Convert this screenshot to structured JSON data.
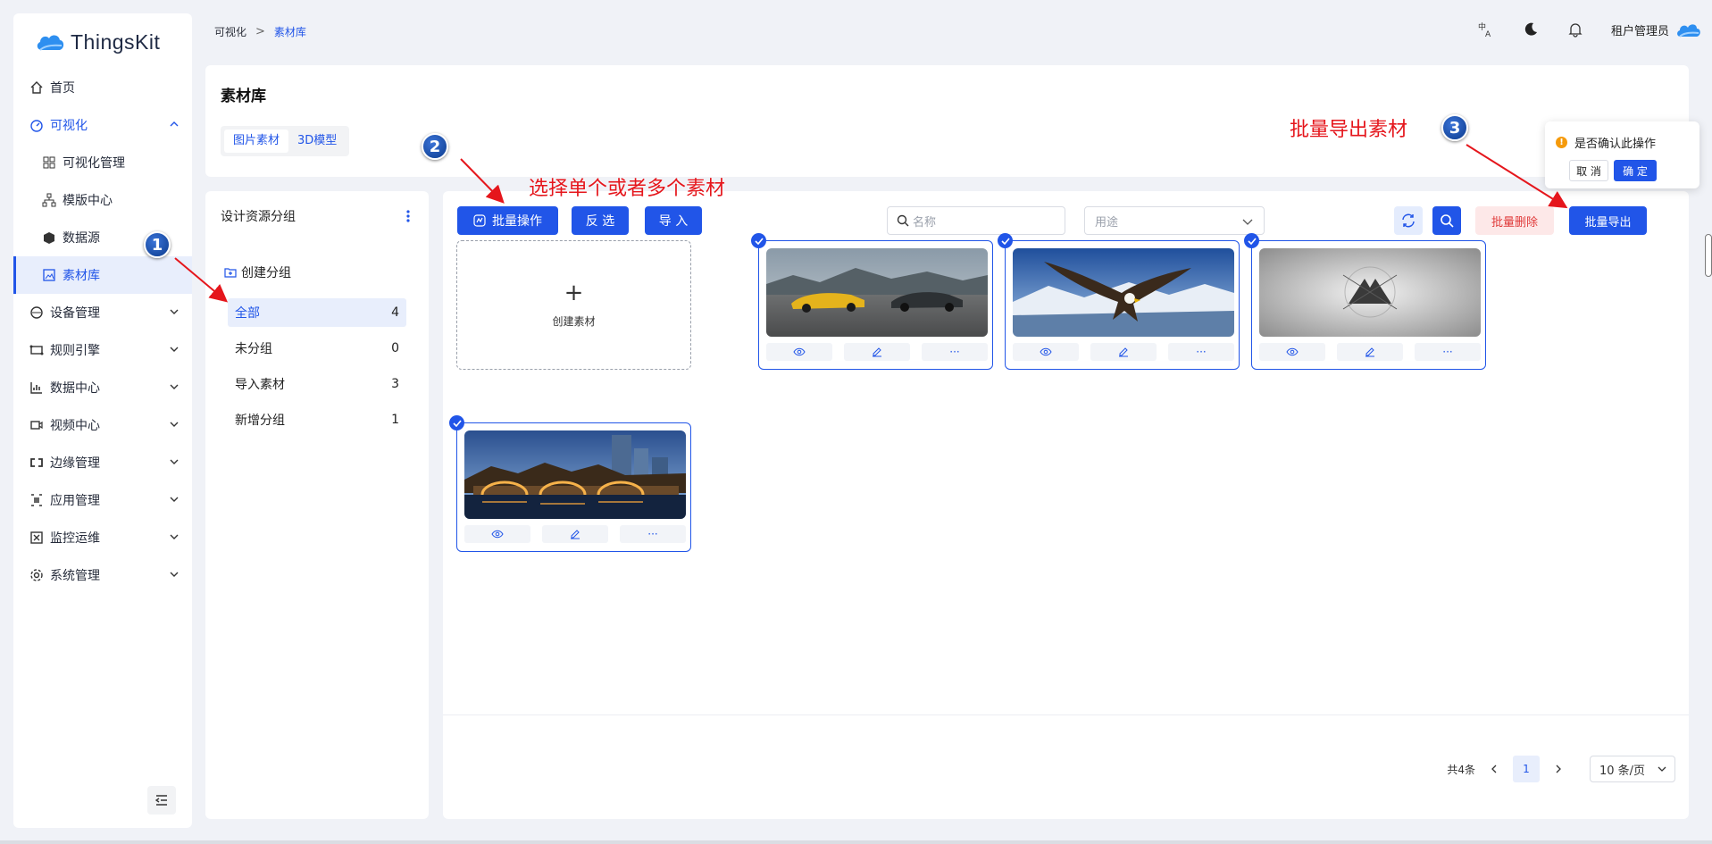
{
  "app": {
    "logo_text": "ThingsKit",
    "brand_color": "#2155e8"
  },
  "sidebar": {
    "items": [
      {
        "label": "首页",
        "icon": "home-icon"
      },
      {
        "label": "可视化",
        "icon": "dashboard-icon",
        "expanded": true
      },
      {
        "label": "可视化管理",
        "icon": "grid-icon",
        "sub": true
      },
      {
        "label": "模版中心",
        "icon": "sitemap-icon",
        "sub": true
      },
      {
        "label": "数据源",
        "icon": "cube-icon",
        "sub": true
      },
      {
        "label": "素材库",
        "icon": "picture-icon",
        "sub": true,
        "active": true
      },
      {
        "label": "设备管理",
        "icon": "device-icon"
      },
      {
        "label": "规则引擎",
        "icon": "rule-icon"
      },
      {
        "label": "数据中心",
        "icon": "chart-icon"
      },
      {
        "label": "视频中心",
        "icon": "video-icon"
      },
      {
        "label": "边缘管理",
        "icon": "edge-icon"
      },
      {
        "label": "应用管理",
        "icon": "app-icon"
      },
      {
        "label": "监控运维",
        "icon": "monitor-icon"
      },
      {
        "label": "系统管理",
        "icon": "settings-icon"
      }
    ]
  },
  "breadcrumb": {
    "parent": "可视化",
    "separator": ">",
    "current": "素材库"
  },
  "header": {
    "user": "租户管理员"
  },
  "page": {
    "title": "素材库",
    "tabs": [
      "图片素材",
      "3D模型"
    ]
  },
  "groups": {
    "title": "设计资源分组",
    "create_label": "创建分组",
    "items": [
      {
        "name": "全部",
        "count": "4"
      },
      {
        "name": "未分组",
        "count": "0"
      },
      {
        "name": "导入素材",
        "count": "3"
      },
      {
        "name": "新增分组",
        "count": "1"
      }
    ]
  },
  "toolbar": {
    "batch_label": "批量操作",
    "invert_label": "反 选",
    "import_label": "导 入",
    "search_placeholder": "名称",
    "purpose_placeholder": "用途",
    "batch_delete_label": "批量删除",
    "batch_export_label": "批量导出"
  },
  "grid": {
    "create_label": "创建素材",
    "more_label": "···",
    "cards": [
      {
        "image": "sports-cars",
        "selected": true
      },
      {
        "image": "eagle",
        "selected": true
      },
      {
        "image": "logo-gray",
        "selected": true
      },
      {
        "image": "bridge-night",
        "selected": true
      }
    ]
  },
  "pagination": {
    "total": "共4条",
    "current_page": "1",
    "page_size": "10 条/页"
  },
  "popconfirm": {
    "message": "是否确认此操作",
    "cancel_label": "取 消",
    "ok_label": "确 定"
  },
  "annotations": {
    "step1": "1",
    "step2": "2",
    "step3": "3",
    "step2_text": "选择单个或者多个素材",
    "step3_text": "批量导出素材",
    "color": "#e5161c"
  }
}
